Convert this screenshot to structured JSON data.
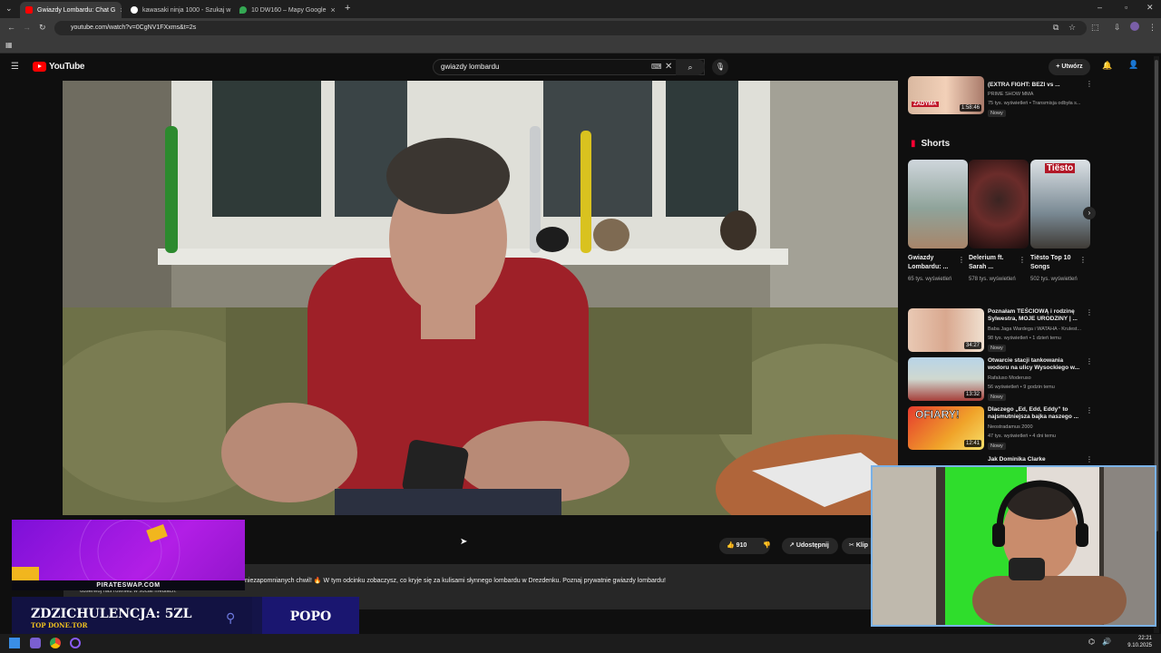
{
  "browser": {
    "tabs": [
      {
        "title": "Gwiazdy Lombardu: Chat G",
        "active": true
      },
      {
        "title": "kawasaki ninja 1000 - Szukaj w",
        "active": false
      },
      {
        "title": "10 DW160 – Mapy Google",
        "active": false
      }
    ],
    "url": "youtube.com/watch?v=0CgNV1FXxms&t=2s"
  },
  "youtube": {
    "logo_text": "YouTube",
    "search_value": "gwiazdy lombardu",
    "create_label": "Utwórz"
  },
  "video_actions": {
    "likes": "910",
    "share_label": "Udostępnij",
    "clip_label": "Klip"
  },
  "description": {
    "text": "niezapomnianych chwil! 🔥 W tym odcinku zobaczysz, co kryje się za kulisami słynnego lombardu w Drezdenku. Poznaj prywatnie gwiazdy lombardu!",
    "line2": "obserwuj nas również w social mediach:"
  },
  "sidebar": {
    "top_video": {
      "title": "(EXTRA FIGHT: BEZI vs ...",
      "channel": "PRIME SHOW MMA",
      "meta": "75 tys. wyświetleń • Transmisja odbyła s...",
      "badge": "Nowy",
      "duration": "1:58:46",
      "thumb_label": "ZADYMA"
    },
    "shorts_heading": "Shorts",
    "shorts": [
      {
        "title": "Gwiazdy Lombardu: ...",
        "views": "65 tys. wyświetleń"
      },
      {
        "title": "Delerium ft. Sarah ...",
        "views": "578 tys. wyświetleń"
      },
      {
        "title": "Tiësto Top 10 Songs",
        "views": "502 tys. wyświetleń",
        "thumb_label": "Tiësto"
      }
    ],
    "videos": [
      {
        "title": "Poznałam TEŚCIOWĄ i rodzinę Sylwestra, MOJE URODZINY | ...",
        "channel": "Baba Jaga Wardega i WATAHA - Krulest...",
        "meta": "98 tys. wyświetleń • 1 dzień temu",
        "badge": "Nowy",
        "duration": "34:27"
      },
      {
        "title": "Otwarcie stacji tankowania wodoru na ulicy Wysockiego w...",
        "channel": "Rafaluso Moderuso",
        "meta": "56 wyświetleń • 9 godzin temu",
        "badge": "Nowy",
        "duration": "13:32"
      },
      {
        "title": "Dlaczego „Ed, Edd, Eddy” to najsmutniejsza bajka naszego ...",
        "channel": "Neostradamus 2000",
        "meta": "47 tys. wyświetleń • 4 dni temu",
        "badge": "Nowy",
        "duration": "12:41",
        "thumb_label": "OFIARY!"
      },
      {
        "title": "Jak Dominika Clarke",
        "channel": "",
        "meta": "",
        "badge": "",
        "duration": ""
      }
    ]
  },
  "overlays": {
    "banner_label": "PIRATESWAP.COM",
    "donor_main": "ZDZICHULENCJA: 5ZL",
    "donor_sub": "TOP DONE.TOR",
    "donor_name": "POPO"
  },
  "taskbar": {
    "time": "22:21",
    "date": "9.10.2025"
  }
}
